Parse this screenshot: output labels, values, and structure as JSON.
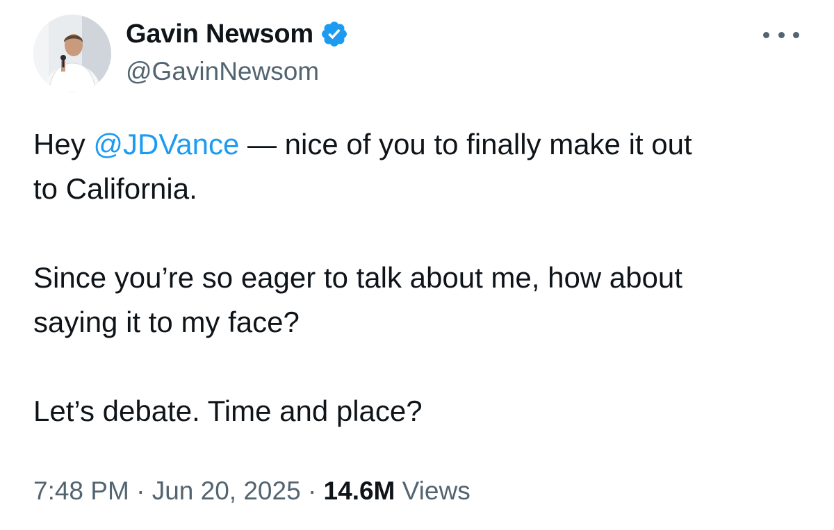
{
  "author": {
    "display_name": "Gavin Newsom",
    "handle": "@GavinNewsom",
    "verified": true,
    "verified_color": "#1d9bf0"
  },
  "tweet": {
    "line1_prefix": "Hey ",
    "mention": "@JDVance",
    "line1_suffix": " — nice of you to finally make it out",
    "line2": "to California.",
    "para2_line1": "Since you’re so eager to talk about me, how about",
    "para2_line2": "saying it to my face?",
    "para3": "Let’s debate. Time and place?"
  },
  "meta": {
    "time": "7:48 PM",
    "date": "Jun 20, 2025",
    "separator": "·",
    "views_count": "14.6M",
    "views_label": "Views"
  },
  "colors": {
    "link": "#1d9bf0",
    "secondary_text": "#536471",
    "primary_text": "#0f1419"
  }
}
